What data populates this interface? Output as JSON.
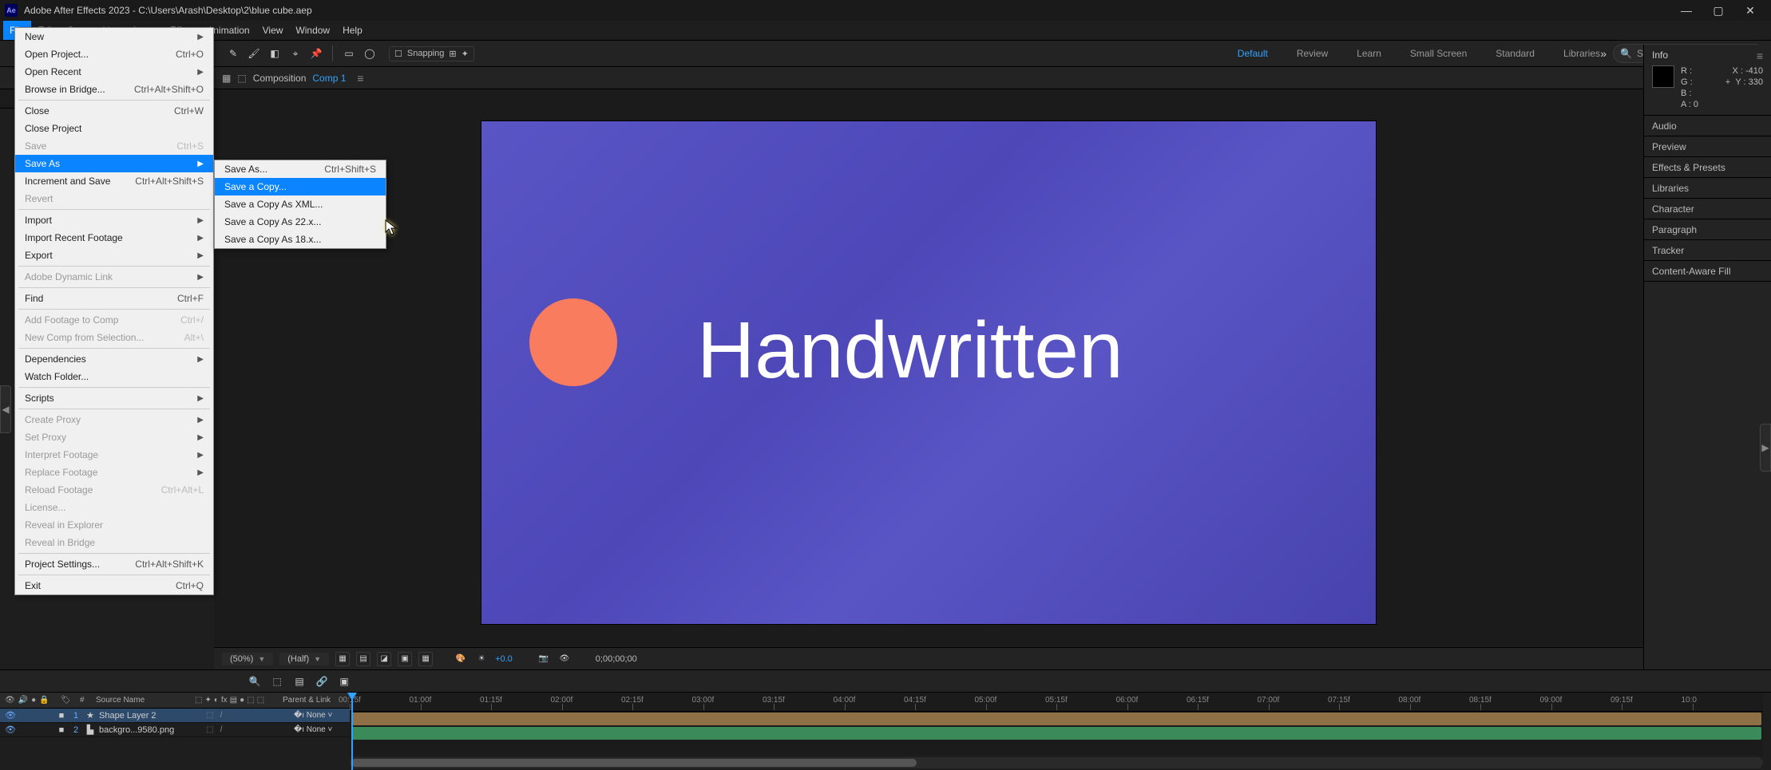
{
  "titlebar": {
    "app_abbrev": "Ae",
    "title": "Adobe After Effects 2023 - C:\\Users\\Arash\\Desktop\\2\\blue cube.aep"
  },
  "menubar": [
    "File",
    "Edit",
    "Composition",
    "Layer",
    "Effect",
    "Animation",
    "View",
    "Window",
    "Help"
  ],
  "toolbar": {
    "snapping_label": "Snapping",
    "workspaces": [
      "Default",
      "Review",
      "Learn",
      "Small Screen",
      "Standard",
      "Libraries"
    ],
    "active_workspace": "Default",
    "search_placeholder": "Search Help"
  },
  "comp_tab": {
    "label": "Composition",
    "name": "Comp 1",
    "breadcrumb": "Comp 1"
  },
  "canvas": {
    "text": "Handwritten"
  },
  "viewer_footer": {
    "zoom": "(50%)",
    "resolution": "(Half)",
    "exposure": "+0.0",
    "timecode": "0;00;00;00"
  },
  "info_panel": {
    "title": "Info",
    "R": "R :",
    "G": "G :",
    "B": "B :",
    "A": "A :  0",
    "X": "X : -410",
    "Y": "Y :  330",
    "plus": "+"
  },
  "right_panels": [
    "Audio",
    "Preview",
    "Effects & Presets",
    "Libraries",
    "Character",
    "Paragraph",
    "Tracker",
    "Content-Aware Fill"
  ],
  "file_menu": {
    "items": [
      {
        "label": "New",
        "shortcut": "",
        "arrow": true
      },
      {
        "label": "Open Project...",
        "shortcut": "Ctrl+O"
      },
      {
        "label": "Open Recent",
        "shortcut": "",
        "arrow": true
      },
      {
        "label": "Browse in Bridge...",
        "shortcut": "Ctrl+Alt+Shift+O"
      },
      {
        "sep": true
      },
      {
        "label": "Close",
        "shortcut": "Ctrl+W"
      },
      {
        "label": "Close Project",
        "shortcut": ""
      },
      {
        "label": "Save",
        "shortcut": "Ctrl+S",
        "disabled": true
      },
      {
        "label": "Save As",
        "shortcut": "",
        "arrow": true,
        "highlight": true
      },
      {
        "label": "Increment and Save",
        "shortcut": "Ctrl+Alt+Shift+S"
      },
      {
        "label": "Revert",
        "shortcut": "",
        "disabled": true
      },
      {
        "sep": true
      },
      {
        "label": "Import",
        "shortcut": "",
        "arrow": true
      },
      {
        "label": "Import Recent Footage",
        "shortcut": "",
        "arrow": true
      },
      {
        "label": "Export",
        "shortcut": "",
        "arrow": true
      },
      {
        "sep": true
      },
      {
        "label": "Adobe Dynamic Link",
        "shortcut": "",
        "arrow": true,
        "disabled": true
      },
      {
        "sep": true
      },
      {
        "label": "Find",
        "shortcut": "Ctrl+F"
      },
      {
        "sep": true
      },
      {
        "label": "Add Footage to Comp",
        "shortcut": "Ctrl+/",
        "disabled": true
      },
      {
        "label": "New Comp from Selection...",
        "shortcut": "Alt+\\",
        "disabled": true
      },
      {
        "sep": true
      },
      {
        "label": "Dependencies",
        "shortcut": "",
        "arrow": true
      },
      {
        "label": "Watch Folder...",
        "shortcut": ""
      },
      {
        "sep": true
      },
      {
        "label": "Scripts",
        "shortcut": "",
        "arrow": true
      },
      {
        "sep": true
      },
      {
        "label": "Create Proxy",
        "shortcut": "",
        "arrow": true,
        "disabled": true
      },
      {
        "label": "Set Proxy",
        "shortcut": "",
        "arrow": true,
        "disabled": true
      },
      {
        "label": "Interpret Footage",
        "shortcut": "",
        "arrow": true,
        "disabled": true
      },
      {
        "label": "Replace Footage",
        "shortcut": "",
        "arrow": true,
        "disabled": true
      },
      {
        "label": "Reload Footage",
        "shortcut": "Ctrl+Alt+L",
        "disabled": true
      },
      {
        "label": "License...",
        "shortcut": "",
        "disabled": true
      },
      {
        "label": "Reveal in Explorer",
        "shortcut": "",
        "disabled": true
      },
      {
        "label": "Reveal in Bridge",
        "shortcut": "",
        "disabled": true
      },
      {
        "sep": true
      },
      {
        "label": "Project Settings...",
        "shortcut": "Ctrl+Alt+Shift+K"
      },
      {
        "sep": true
      },
      {
        "label": "Exit",
        "shortcut": "Ctrl+Q"
      }
    ]
  },
  "saveas_submenu": [
    {
      "label": "Save As...",
      "shortcut": "Ctrl+Shift+S"
    },
    {
      "label": "Save a Copy...",
      "highlight": true
    },
    {
      "label": "Save a Copy As XML..."
    },
    {
      "label": "Save a Copy As 22.x..."
    },
    {
      "label": "Save a Copy As 18.x..."
    }
  ],
  "timeline": {
    "ruler": [
      "00:15f",
      "01:00f",
      "01:15f",
      "02:00f",
      "02:15f",
      "03:00f",
      "03:15f",
      "04:00f",
      "04:15f",
      "05:00f",
      "05:15f",
      "06:00f",
      "06:15f",
      "07:00f",
      "07:15f",
      "08:00f",
      "08:15f",
      "09:00f",
      "09:15f",
      "10:0"
    ],
    "header_source": "Source Name",
    "header_parent": "Parent & Link",
    "rows": [
      {
        "num": "1",
        "name": "Shape Layer 2",
        "mode": "None",
        "star": true,
        "selected": true
      },
      {
        "num": "2",
        "name": "backgro...9580.png",
        "mode": "None",
        "star": false,
        "selected": false
      }
    ],
    "none_label": "None"
  }
}
